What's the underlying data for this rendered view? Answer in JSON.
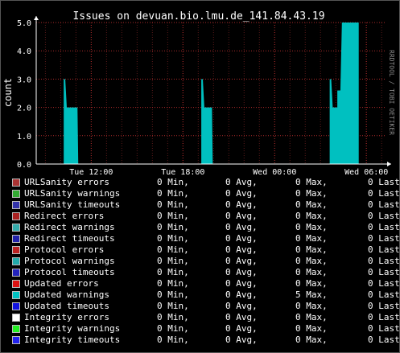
{
  "chart_data": {
    "type": "area",
    "title": "Issues on devuan.bio.lmu.de_141.84.43.19",
    "ylabel": "count",
    "watermark": "RRDTOOL / TOBI OETIKER",
    "ylim": [
      0,
      5
    ],
    "y_ticks": [
      "0.0",
      "1.0",
      "2.0",
      "3.0",
      "4.0",
      "5.0"
    ],
    "xlim_hours": [
      8.4,
      31.2
    ],
    "x_ticks": [
      {
        "label": "Tue 12:00",
        "hour": 12
      },
      {
        "label": "Tue 18:00",
        "hour": 18
      },
      {
        "label": "Wed 00:00",
        "hour": 24
      },
      {
        "label": "Wed 06:00",
        "hour": 30
      }
    ],
    "series": [
      {
        "name": "Updated warnings",
        "color": "#00c0c0",
        "points": [
          [
            8.4,
            0
          ],
          [
            10.2,
            0
          ],
          [
            10.2,
            3
          ],
          [
            10.3,
            3
          ],
          [
            10.4,
            2
          ],
          [
            11.1,
            2
          ],
          [
            11.15,
            0
          ],
          [
            19.2,
            0
          ],
          [
            19.2,
            3
          ],
          [
            19.3,
            3
          ],
          [
            19.4,
            2
          ],
          [
            19.9,
            2
          ],
          [
            19.95,
            0
          ],
          [
            27.6,
            0
          ],
          [
            27.6,
            3
          ],
          [
            27.7,
            3
          ],
          [
            27.8,
            2
          ],
          [
            28.1,
            2
          ],
          [
            28.1,
            2.6
          ],
          [
            28.3,
            2.6
          ],
          [
            28.4,
            5
          ],
          [
            29.5,
            5
          ],
          [
            29.5,
            0
          ],
          [
            31.2,
            0
          ]
        ]
      }
    ]
  },
  "legend": [
    {
      "name": "URLSanity errors",
      "color": "#aa3333",
      "min": "0 Min,",
      "avg": "0 Avg,",
      "max": "0 Max,",
      "last": "0 Last"
    },
    {
      "name": "URLSanity warnings",
      "color": "#33aa33",
      "min": "0 Min,",
      "avg": "0 Avg,",
      "max": "0 Max,",
      "last": "0 Last"
    },
    {
      "name": "URLSanity timeouts",
      "color": "#3333aa",
      "min": "0 Min,",
      "avg": "0 Avg,",
      "max": "0 Max,",
      "last": "0 Last"
    },
    {
      "name": "Redirect errors",
      "color": "#aa2222",
      "min": "0 Min,",
      "avg": "0 Avg,",
      "max": "0 Max,",
      "last": "0 Last"
    },
    {
      "name": "Redirect warnings",
      "color": "#33aaaa",
      "min": "0 Min,",
      "avg": "0 Avg,",
      "max": "0 Max,",
      "last": "0 Last"
    },
    {
      "name": "Redirect timeouts",
      "color": "#2222aa",
      "min": "0 Min,",
      "avg": "0 Avg,",
      "max": "0 Max,",
      "last": "0 Last"
    },
    {
      "name": "Protocol errors",
      "color": "#bb2222",
      "min": "0 Min,",
      "avg": "0 Avg,",
      "max": "0 Max,",
      "last": "0 Last"
    },
    {
      "name": "Protocol warnings",
      "color": "#22aaaa",
      "min": "0 Min,",
      "avg": "0 Avg,",
      "max": "0 Max,",
      "last": "0 Last"
    },
    {
      "name": "Protocol timeouts",
      "color": "#2222bb",
      "min": "0 Min,",
      "avg": "0 Avg,",
      "max": "0 Max,",
      "last": "0 Last"
    },
    {
      "name": "Updated errors",
      "color": "#dd1111",
      "min": "0 Min,",
      "avg": "0 Avg,",
      "max": "0 Max,",
      "last": "0 Last"
    },
    {
      "name": "Updated warnings",
      "color": "#00c0c0",
      "min": "0 Min,",
      "avg": "0 Avg,",
      "max": "5 Max,",
      "last": "0 Last"
    },
    {
      "name": "Updated timeouts",
      "color": "#1111dd",
      "min": "0 Min,",
      "avg": "0 Avg,",
      "max": "0 Max,",
      "last": "0 Last"
    },
    {
      "name": "Integrity errors",
      "color": "#ffffff",
      "min": "0 Min,",
      "avg": "0 Avg,",
      "max": "0 Max,",
      "last": "0 Last"
    },
    {
      "name": "Integrity warnings",
      "color": "#22ee22",
      "min": "0 Min,",
      "avg": "0 Avg,",
      "max": "0 Max,",
      "last": "0 Last"
    },
    {
      "name": "Integrity timeouts",
      "color": "#2222ee",
      "min": "0 Min,",
      "avg": "0 Avg,",
      "max": "0 Max,",
      "last": "0 Last"
    }
  ]
}
